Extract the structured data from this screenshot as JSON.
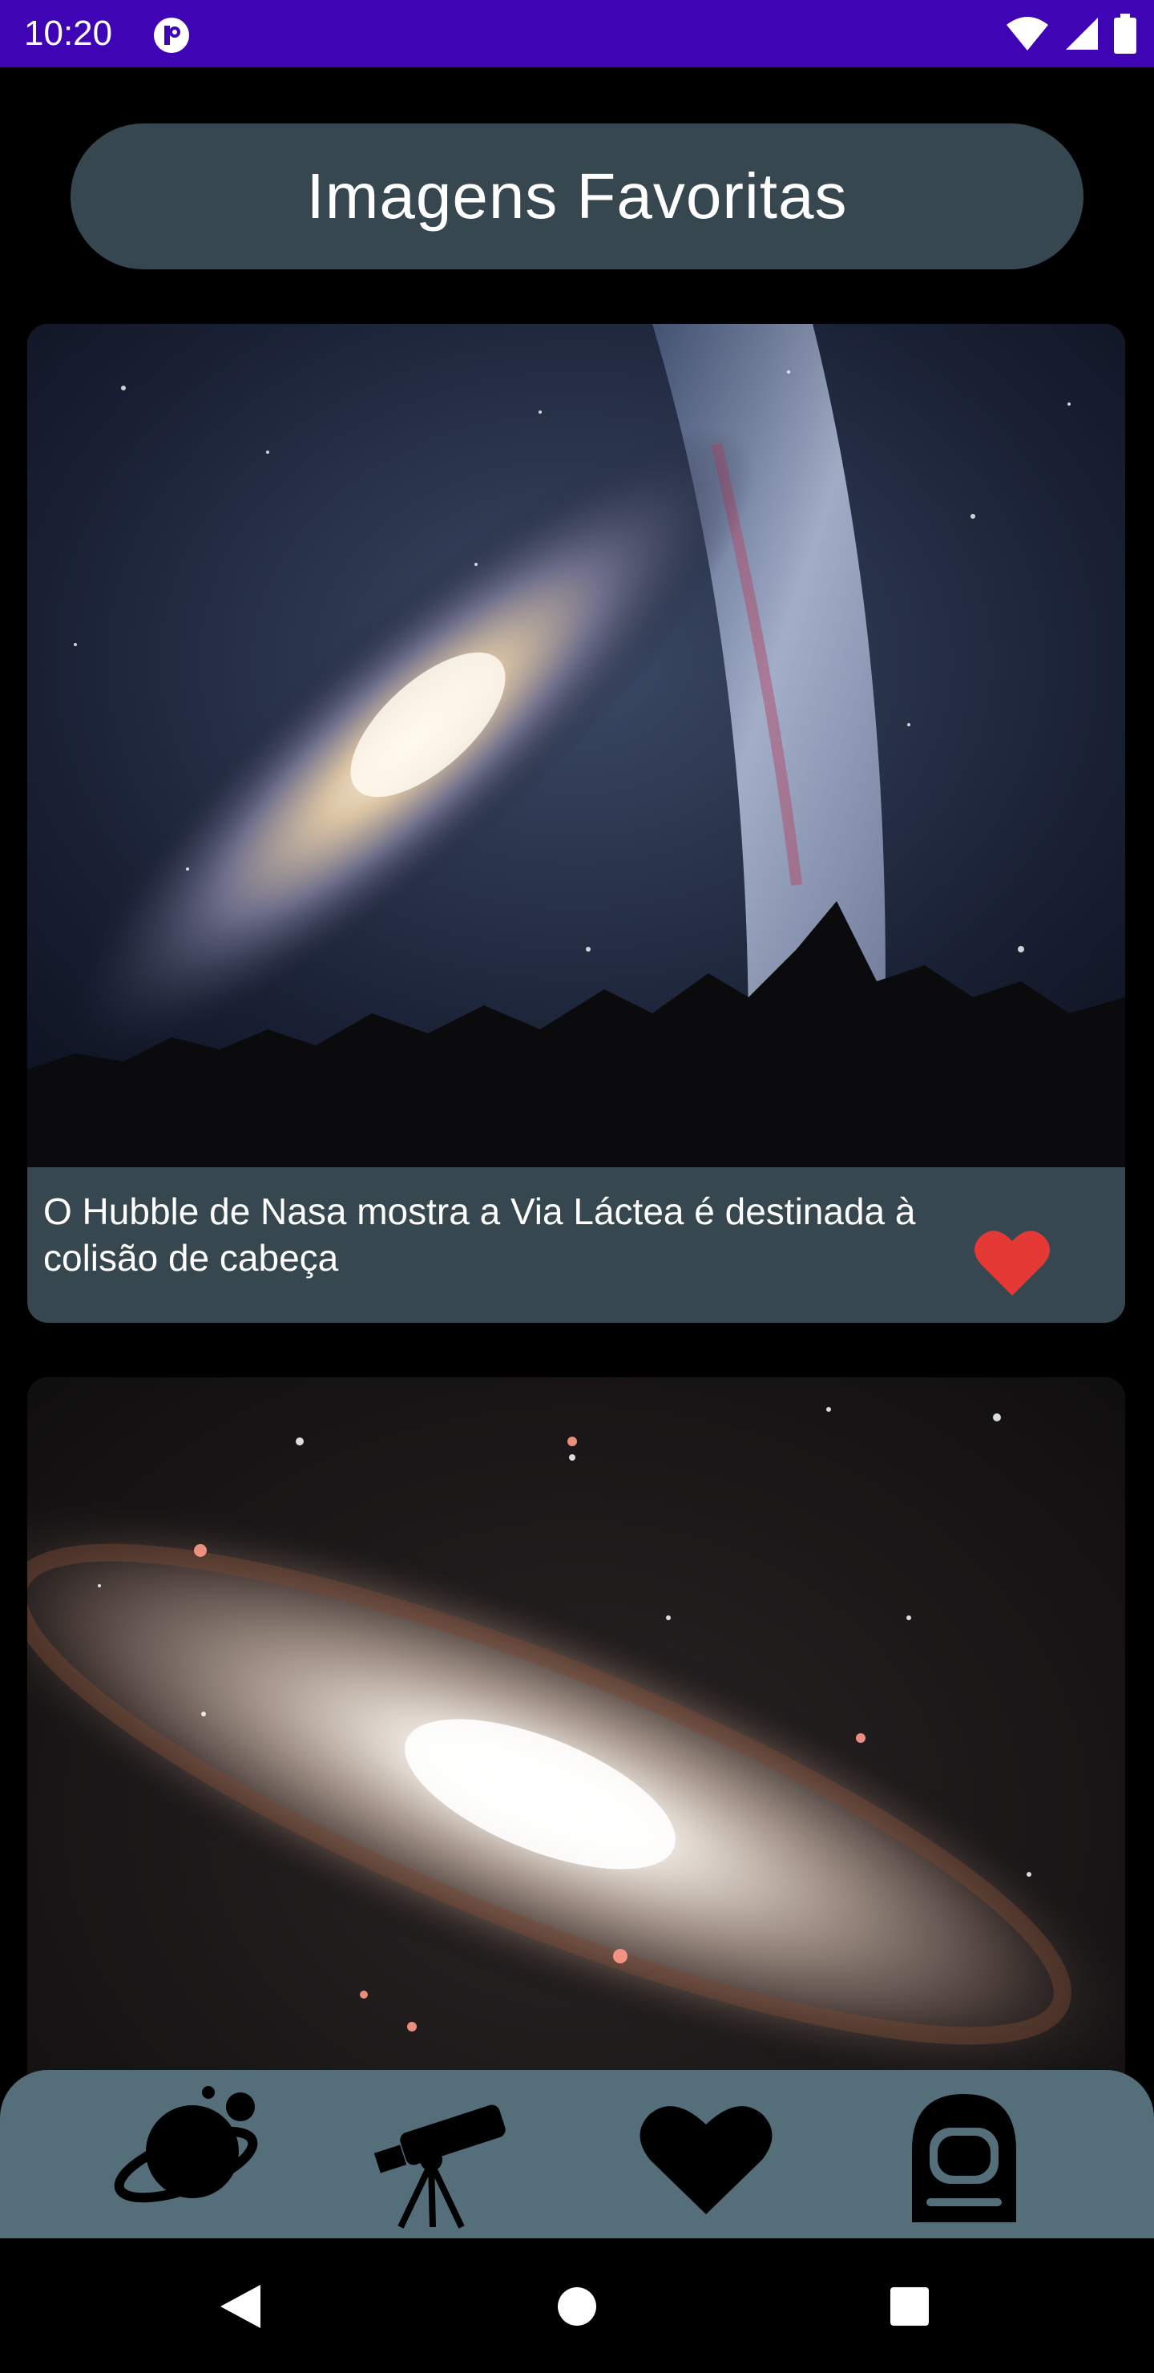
{
  "status_bar": {
    "time": "10:20",
    "color": "#3f05b4",
    "icons": [
      "app-notification-icon",
      "wifi-icon",
      "cellular-signal-icon",
      "battery-icon"
    ]
  },
  "header": {
    "title": "Imagens Favoritas"
  },
  "cards": [
    {
      "image": "galaxy-collision-image",
      "caption": "O Hubble de Nasa mostra a Via Láctea é destinada à colisão de cabeça",
      "favorite": true,
      "favorite_icon": "heart-icon",
      "favorite_color": "#e53935"
    },
    {
      "image": "andromeda-galaxy-image"
    }
  ],
  "bottom_nav": {
    "items": [
      {
        "icon": "planet-icon"
      },
      {
        "icon": "telescope-icon"
      },
      {
        "icon": "heart-icon"
      },
      {
        "icon": "astronaut-helmet-icon"
      }
    ]
  },
  "system_nav": {
    "buttons": [
      "back-icon",
      "home-icon",
      "recents-icon"
    ]
  },
  "colors": {
    "surface": "#37474f",
    "nav_background": "#546e7a",
    "background": "#000000"
  }
}
